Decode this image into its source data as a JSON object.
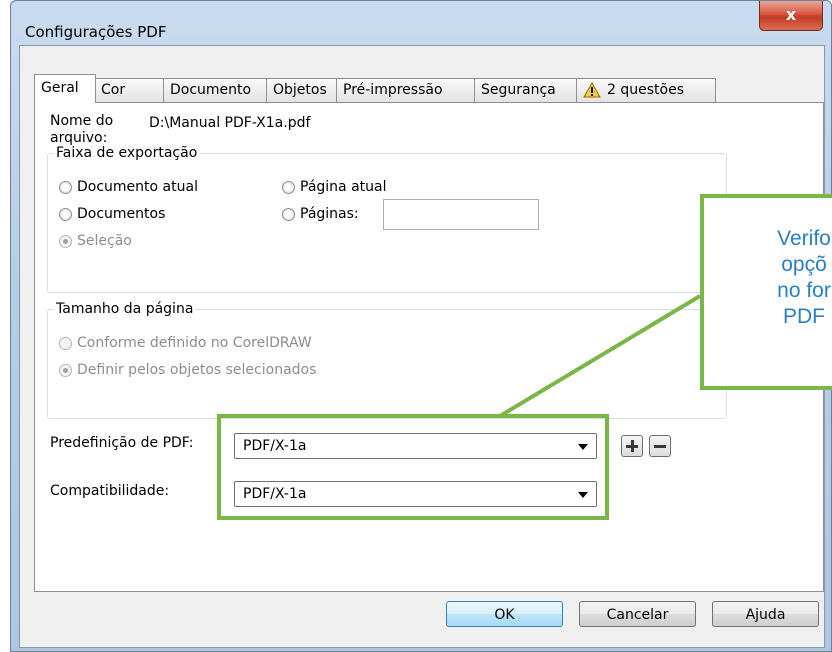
{
  "window": {
    "title": "Configurações PDF",
    "close_label": "x"
  },
  "tabs": [
    {
      "label": "Geral"
    },
    {
      "label": "Cor"
    },
    {
      "label": "Documento"
    },
    {
      "label": "Objetos"
    },
    {
      "label": "Pré-impressão"
    },
    {
      "label": "Segurança"
    },
    {
      "label": "2 questões"
    }
  ],
  "general": {
    "filename_label": "Nome do\narquivo:",
    "filename_value": "D:\\Manual PDF-X1a.pdf"
  },
  "export_range": {
    "legend": "Faixa de exportação",
    "options": {
      "current_document": "Documento atual",
      "documents": "Documentos",
      "selection": "Seleção",
      "current_page": "Página atual",
      "pages": "Páginas:"
    },
    "pages_value": ""
  },
  "page_size": {
    "legend": "Tamanho da página",
    "options": {
      "as_defined": "Conforme definido no CorelDRAW",
      "by_objects": "Definir pelos objetos selecionados"
    }
  },
  "preset": {
    "label": "Predefinição de PDF:",
    "value": "PDF/X-1a"
  },
  "compatibility": {
    "label": "Compatibilidade:",
    "value": "PDF/X-1a"
  },
  "buttons": {
    "ok": "OK",
    "cancel": "Cancelar",
    "help": "Ajuda"
  },
  "annotation": {
    "text": "Verifo\nopçõ\nno for\nPDF"
  },
  "colors": {
    "highlight": "#7ab648",
    "callout_text": "#2b7fc5"
  }
}
